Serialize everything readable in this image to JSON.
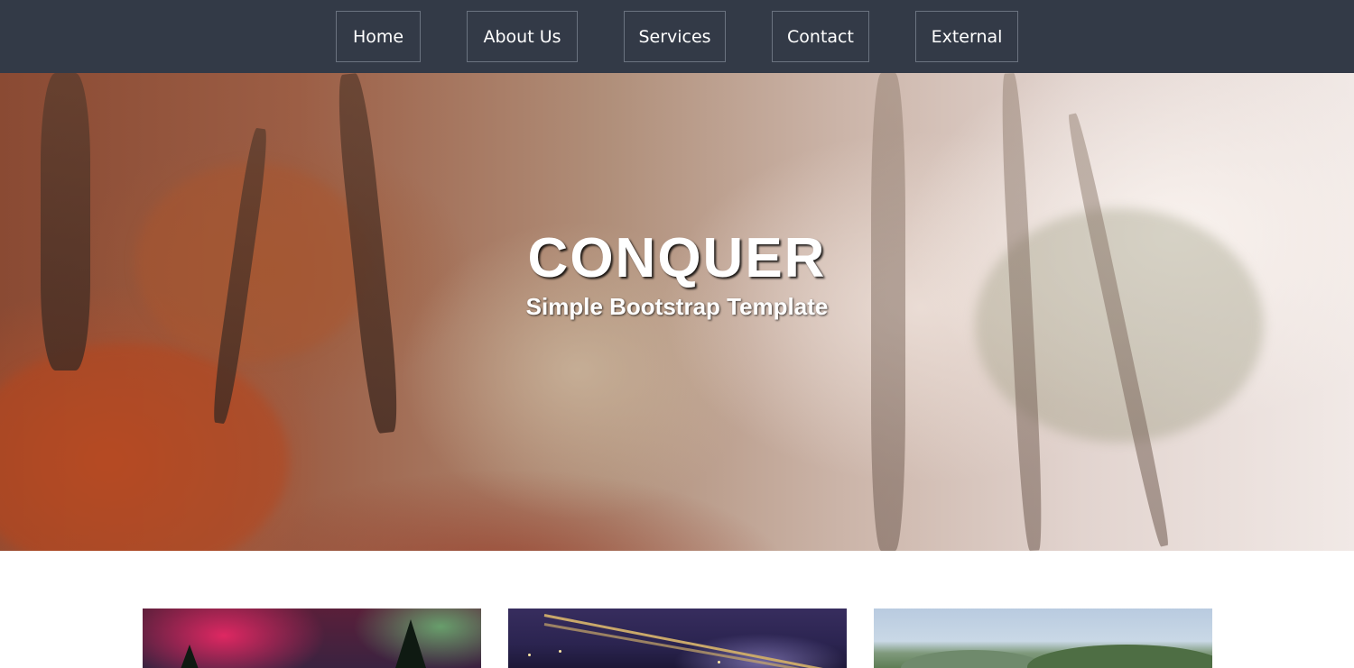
{
  "nav": {
    "items": [
      {
        "label": "Home"
      },
      {
        "label": "About Us"
      },
      {
        "label": "Services"
      },
      {
        "label": "Contact"
      },
      {
        "label": "External"
      }
    ]
  },
  "hero": {
    "title": "CONQUER",
    "subtitle": "Simple Bootstrap Template"
  },
  "cards": [
    {
      "image": "aurora-forest-image"
    },
    {
      "image": "city-bridge-night-image"
    },
    {
      "image": "green-hills-image"
    }
  ],
  "colors": {
    "navbar_bg": "#333a47",
    "nav_border": "#6b7380",
    "text_light": "#ffffff"
  }
}
